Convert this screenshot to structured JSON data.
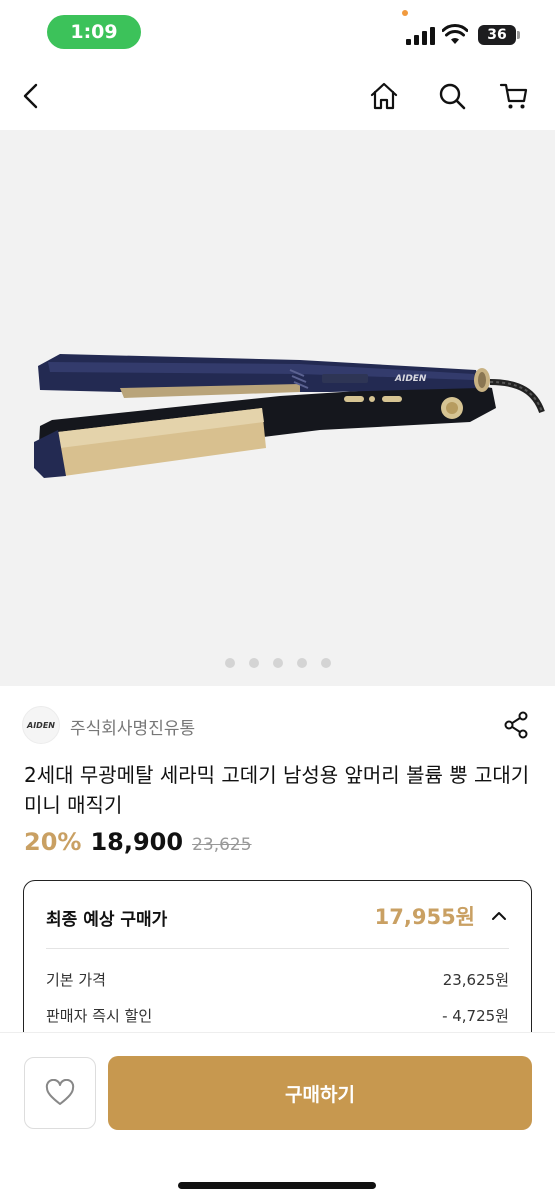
{
  "status_bar": {
    "time": "1:09",
    "battery": "36"
  },
  "nav": {
    "back_icon": "chevron-left-icon",
    "home_icon": "home-icon",
    "search_icon": "search-icon",
    "cart_icon": "cart-icon"
  },
  "hero": {
    "image_subject": "hair-straightener",
    "brand_on_device": "AIDEN",
    "carousel_dots": 5,
    "active_dot": 0
  },
  "seller": {
    "logo_text": "AIDEN",
    "name": "주식회사명진유통"
  },
  "product": {
    "title": "2세대 무광메탈 세라믹 고데기 남성용 앞머리 볼륨 뿡 고대기 미니 매직기",
    "discount": "20%",
    "price": "18,900",
    "original_price": "23,625"
  },
  "final_price": {
    "label": "최종 예상 구매가",
    "value": "17,955원",
    "rows": [
      {
        "label": "기본 가격",
        "value": "23,625원"
      },
      {
        "label": "판매자 즉시 할인",
        "value": "- 4,725원"
      }
    ]
  },
  "bottom": {
    "buy_label": "구매하기",
    "like_icon": "heart-icon"
  },
  "colors": {
    "accent": "#c7984f",
    "price_accent": "#c9a063",
    "status_green": "#3cc25a"
  }
}
